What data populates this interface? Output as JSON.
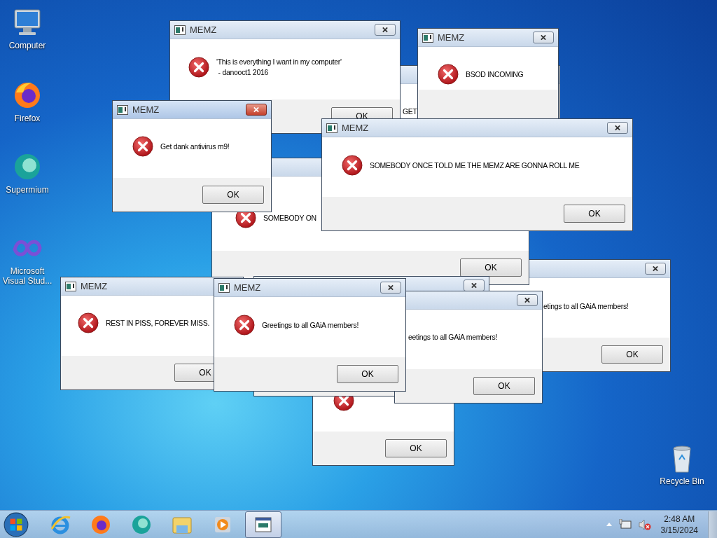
{
  "desktop_icons": [
    {
      "label": "Computer"
    },
    {
      "label": "Firefox"
    },
    {
      "label": "Supermium"
    },
    {
      "label": "Microsoft Visual Stud..."
    },
    {
      "label": "Recycle Bin"
    }
  ],
  "dialogs": [
    {
      "message": "GET"
    },
    {
      "title": "MEMZ",
      "message": "'This is everything I want in my computer'\n - danooct1 2016",
      "button": "OK",
      "active": false
    },
    {
      "title": "MEMZ",
      "message": "BSOD INCOMING",
      "active": false
    },
    {
      "message": "etings to all GAiA members!",
      "button": "OK",
      "active": false
    },
    {
      "message": "SOMEBODY ON",
      "button": "OK"
    },
    {
      "title": "MEMZ",
      "message": "Get dank antivirus m9!",
      "button": "OK",
      "active": true
    },
    {
      "title": "MEMZ",
      "message": "SOMEBODY ONCE TOLD ME THE MEMZ ARE GONNA ROLL ME",
      "button": "OK",
      "active": false
    },
    {
      "button": "OK"
    },
    {
      "active": false
    },
    {
      "message": "eetings to all GAiA members!",
      "button": "OK",
      "active": false
    },
    {
      "title": "MEMZ",
      "message": "REST IN PISS, FOREVER MISS.",
      "button": "OK"
    },
    {
      "title": "MEMZ",
      "message": "Greetings to all GAiA members!",
      "button": "OK",
      "active": false
    }
  ],
  "taskbar": {
    "items": [
      {
        "selected": false
      },
      {
        "selected": false
      },
      {
        "selected": false
      },
      {
        "selected": false
      },
      {
        "selected": false
      },
      {
        "selected": true
      }
    ],
    "clock": {
      "time": "2:48 AM",
      "date": "3/15/2024"
    }
  }
}
